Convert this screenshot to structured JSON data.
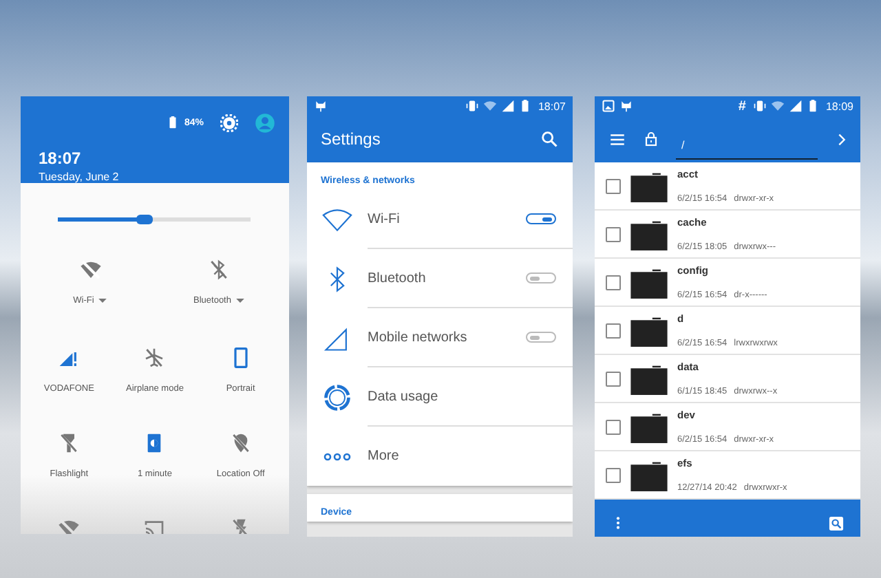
{
  "quick_settings": {
    "battery": "84%",
    "time": "18:07",
    "date": "Tuesday, June 2",
    "brightness": {
      "level": 0.45
    },
    "tiles": [
      {
        "kind": "wifi",
        "label": "Wi-Fi",
        "on": false,
        "dropdown": true
      },
      {
        "kind": "bluetooth",
        "label": "Bluetooth",
        "on": false,
        "dropdown": true
      },
      {
        "kind": "signal",
        "label": "VODAFONE",
        "on": true
      },
      {
        "kind": "airplane",
        "label": "Airplane mode",
        "on": false
      },
      {
        "kind": "rotation",
        "label": "Portrait",
        "on": true
      },
      {
        "kind": "flashlight",
        "label": "Flashlight",
        "on": false
      },
      {
        "kind": "timeout",
        "label": "1 minute",
        "on": true
      },
      {
        "kind": "location",
        "label": "Location Off",
        "on": false
      },
      {
        "kind": "hotspot",
        "on": false
      },
      {
        "kind": "cast",
        "on": false
      },
      {
        "kind": "flash",
        "on": false
      }
    ]
  },
  "settings": {
    "status_time": "18:07",
    "title": "Settings",
    "sections": [
      {
        "header": "Wireless & networks",
        "items": [
          {
            "kind": "wifi",
            "label": "Wi-Fi",
            "on": true
          },
          {
            "kind": "bluetooth",
            "label": "Bluetooth",
            "on": false
          },
          {
            "kind": "signal",
            "label": "Mobile networks",
            "on": false
          },
          {
            "kind": "usage",
            "label": "Data usage"
          },
          {
            "kind": "more",
            "label": "More"
          }
        ]
      },
      {
        "header": "Device"
      }
    ]
  },
  "file_manager": {
    "status_symbol": "#",
    "status_time": "18:09",
    "path": "/",
    "files": [
      {
        "name": "acct",
        "modified": "6/2/15 16:54",
        "permissions": "drwxr-xr-x",
        "checked": false
      },
      {
        "name": "cache",
        "modified": "6/2/15 18:05",
        "permissions": "drwxrwx---",
        "checked": false
      },
      {
        "name": "config",
        "modified": "6/2/15 16:54",
        "permissions": "dr-x------",
        "checked": false
      },
      {
        "name": "d",
        "modified": "6/2/15 16:54",
        "permissions": "lrwxrwxrwx",
        "checked": false
      },
      {
        "name": "data",
        "modified": "6/1/15 18:45",
        "permissions": "drwxrwx--x",
        "checked": false
      },
      {
        "name": "dev",
        "modified": "6/2/15 16:54",
        "permissions": "drwxr-xr-x",
        "checked": false
      },
      {
        "name": "efs",
        "modified": "12/27/14 20:42",
        "permissions": "drwxrwxr-x",
        "checked": false
      }
    ]
  }
}
